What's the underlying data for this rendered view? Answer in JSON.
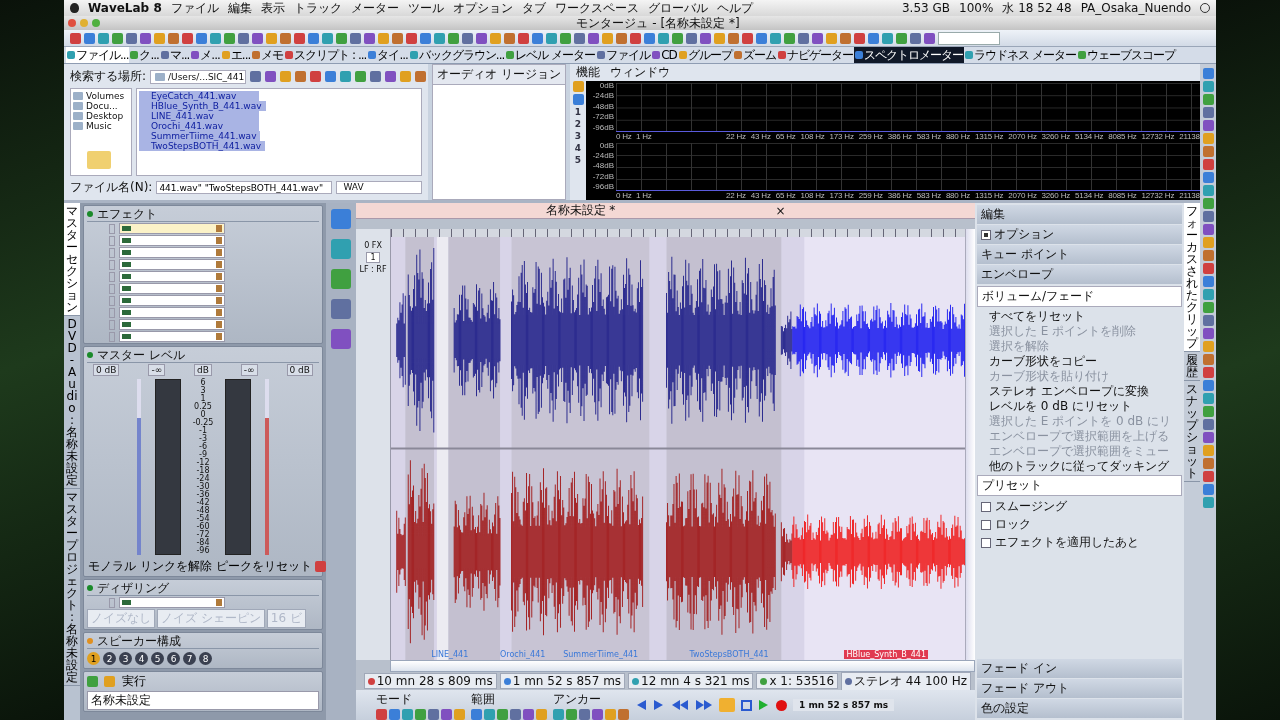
{
  "menubar": {
    "app": "WaveLab 8",
    "menus": [
      "ファイル",
      "編集",
      "表示",
      "トラック",
      "メーター",
      "ツール",
      "オプション",
      "タブ",
      "ワークスペース",
      "グローバル",
      "ヘルプ"
    ],
    "status": [
      "3.53 GB",
      "100%",
      "水 18 52 48",
      "PA_Osaka_Nuendo"
    ]
  },
  "window": {
    "title": "モンタージュ - [名称未設定 *]"
  },
  "tool_tabs": [
    {
      "label": "ファイル...",
      "selected": true
    },
    {
      "label": "ク...",
      "selected": false
    },
    {
      "label": "マ...",
      "selected": false
    },
    {
      "label": "メ...",
      "selected": false
    },
    {
      "label": "エ...",
      "selected": false
    },
    {
      "label": "メモ",
      "selected": false
    },
    {
      "label": "スクリプト : ...",
      "selected": false
    },
    {
      "label": "タイ...",
      "selected": false
    },
    {
      "label": "バックグラウン...",
      "selected": false
    },
    {
      "label": "レベル メーター",
      "selected": false
    },
    {
      "label": "ファイル",
      "selected": false
    },
    {
      "label": "CD",
      "selected": false
    },
    {
      "label": "グループ",
      "selected": false
    },
    {
      "label": "ズーム",
      "selected": false
    },
    {
      "label": "ナビゲーター",
      "selected": false
    },
    {
      "label": "スペクトロメーター",
      "selected": true
    },
    {
      "label": "ラウドネス メーター",
      "selected": false
    },
    {
      "label": "ウェーブスコープ",
      "selected": false
    }
  ],
  "file_browser": {
    "location_label": "検索する場所:",
    "path": "/Users/...SIC_441",
    "folders": [
      "Volumes",
      "Docu...",
      "Desktop",
      "Music"
    ],
    "files": [
      {
        "name": "EyeCatch_441.wav",
        "selected": true
      },
      {
        "name": "HBlue_Synth_B_441.wav",
        "selected": true
      },
      {
        "name": "LINE_441.wav",
        "selected": true
      },
      {
        "name": "Orochi_441.wav",
        "selected": true
      },
      {
        "name": "SummerTiime_441.wav",
        "selected": true
      },
      {
        "name": "TwoStepsBOTH_441.wav",
        "selected": true
      }
    ],
    "filename_label": "ファイル名(N):",
    "filename": "441.wav\" \"TwoStepsBOTH_441.wav\"",
    "filetype": "WAV"
  },
  "audio_regions": {
    "title": "オーディオ リージョン"
  },
  "spectrometer": {
    "menus": [
      "機能",
      "ウィンドウ"
    ],
    "presets": [
      "1",
      "2",
      "3",
      "4",
      "5"
    ],
    "channels": [
      {
        "y_labels": [
          "0dB",
          "-24dB",
          "-48dB",
          "-72dB",
          "-96dB"
        ],
        "x_labels": [
          "0 Hz",
          "1 Hz",
          "22 Hz",
          "43 Hz",
          "65 Hz",
          "108 Hz",
          "173 Hz",
          "259 Hz",
          "386 Hz",
          "583 Hz",
          "880 Hz",
          "1315 Hz",
          "2070 Hz",
          "3260 Hz",
          "5134 Hz",
          "8085 Hz",
          "12732 Hz",
          "21138"
        ]
      },
      {
        "y_labels": [
          "0dB",
          "-24dB",
          "-48dB",
          "-72dB",
          "-96dB"
        ],
        "x_labels": [
          "0 Hz",
          "1 Hz",
          "22 Hz",
          "43 Hz",
          "65 Hz",
          "108 Hz",
          "173 Hz",
          "259 Hz",
          "386 Hz",
          "583 Hz",
          "880 Hz",
          "1315 Hz",
          "2070 Hz",
          "3260 Hz",
          "5134 Hz",
          "8085 Hz",
          "12732 Hz",
          "21138"
        ]
      }
    ]
  },
  "left_tabs": [
    {
      "label": "マスターセクション",
      "selected": true
    },
    {
      "label": "DVD-Audio : 名称未設定",
      "selected": false
    },
    {
      "label": "マスタープロジェクト : 名称未設定",
      "selected": false
    }
  ],
  "master": {
    "effects": {
      "title": "エフェクト",
      "slots": [
        {
          "selected": true
        },
        {
          "selected": false
        },
        {
          "selected": false
        },
        {
          "selected": false
        },
        {
          "selected": false
        },
        {
          "selected": false
        },
        {
          "selected": false
        },
        {
          "selected": false
        },
        {
          "selected": false
        },
        {
          "selected": false
        }
      ]
    },
    "level": {
      "title": "マスター レベル",
      "readouts": [
        "0 dB",
        "-∞",
        "dB",
        "-∞",
        "0 dB"
      ],
      "scale": [
        "6",
        "3",
        "1",
        "0.25",
        "0",
        "-0.25",
        "-1",
        "-3",
        "-6",
        "-9",
        "-12",
        "-18",
        "-24",
        "-30",
        "-36",
        "-42",
        "-48",
        "-54",
        "-60",
        "-72",
        "-84",
        "-96"
      ],
      "faders": [
        {
          "level": 0.78,
          "color": "#7484cc"
        },
        {
          "level": 0.78,
          "color": "#cc5a5a"
        }
      ],
      "buttons": [
        "モノラル",
        "リンクを解除",
        "ピークをリセット"
      ]
    },
    "dithering": {
      "title": "ディザリング",
      "options": [
        "ノイズなし",
        "ノイズ シェーピン",
        "16 ビ"
      ]
    },
    "speakers": {
      "title": "スピーカー構成",
      "configs": [
        {
          "label": "1",
          "selected": true
        },
        {
          "label": "2",
          "selected": false
        },
        {
          "label": "3",
          "selected": false
        },
        {
          "label": "4",
          "selected": false
        },
        {
          "label": "5",
          "selected": false
        },
        {
          "label": "6",
          "selected": false
        },
        {
          "label": "7",
          "selected": false
        },
        {
          "label": "8",
          "selected": false
        }
      ]
    },
    "render": {
      "label": "実行",
      "preset": "名称未設定"
    }
  },
  "montage": {
    "tab": "名称未設定 *",
    "close": "×",
    "track": {
      "fx": "0 FX",
      "number": "1",
      "routing": "LF : RF"
    },
    "clips": [
      {
        "label": "LINE_441",
        "selected": false
      },
      {
        "label": "Orochi_441",
        "selected": false
      },
      {
        "label": "SummerTiime_441",
        "selected": false
      },
      {
        "label": "TwoStepsBOTH_441",
        "selected": false
      },
      {
        "label": "HBlue_Synth_B_441",
        "selected": true
      }
    ],
    "status": [
      "10 mn 28 s 809 ms",
      "1 mn 52 s 857 ms",
      "12 mn 4 s 321 ms",
      "x 1: 53516",
      "ステレオ 44 100 Hz"
    ],
    "transport": {
      "groups": [
        "モード",
        "範囲",
        "アンカー"
      ],
      "loop": true,
      "time": "1 mn 52 s 857 ms"
    }
  },
  "inspector": {
    "sections": [
      {
        "label": "編集",
        "kind": "header"
      },
      {
        "label": "オプション",
        "kind": "check",
        "checked": true
      },
      {
        "label": "キュー ポイント",
        "kind": "header"
      },
      {
        "label": "エンベロープ",
        "kind": "header"
      }
    ],
    "envelope_mode": "ボリューム/フェード",
    "actions": [
      {
        "label": "すべてをリセット",
        "disabled": false
      },
      {
        "label": "選択した E ポイントを削除",
        "disabled": true
      },
      {
        "label": "選択を解除",
        "disabled": true
      },
      {
        "label": "カーブ形状をコピー",
        "disabled": false
      },
      {
        "label": "カーブ形状を貼り付け",
        "disabled": true
      },
      {
        "label": "ステレオ エンベロープに変換",
        "disabled": false
      },
      {
        "label": "レベルを 0 dB にリセット",
        "disabled": false
      },
      {
        "label": "選択した E ポイントを 0 dB にリ",
        "disabled": true
      },
      {
        "label": "エンベロープで選択範囲を上げる",
        "disabled": true
      },
      {
        "label": "エンベロープで選択範囲をミュー",
        "disabled": true
      },
      {
        "label": "他のトラックに従ってダッキング",
        "disabled": false
      }
    ],
    "preset": "プリセット",
    "options": [
      {
        "label": "スムージング",
        "checked": false
      },
      {
        "label": "ロック",
        "checked": false
      },
      {
        "label": "エフェクトを適用したあと",
        "checked": false
      }
    ],
    "footer": [
      "フェード イン",
      "フェード アウト",
      "色の設定"
    ]
  },
  "right_tabs": [
    {
      "label": "フォーカスされたクリップ",
      "selected": true
    },
    {
      "label": "履歴",
      "selected": false
    },
    {
      "label": "スナップショット",
      "selected": false
    }
  ]
}
